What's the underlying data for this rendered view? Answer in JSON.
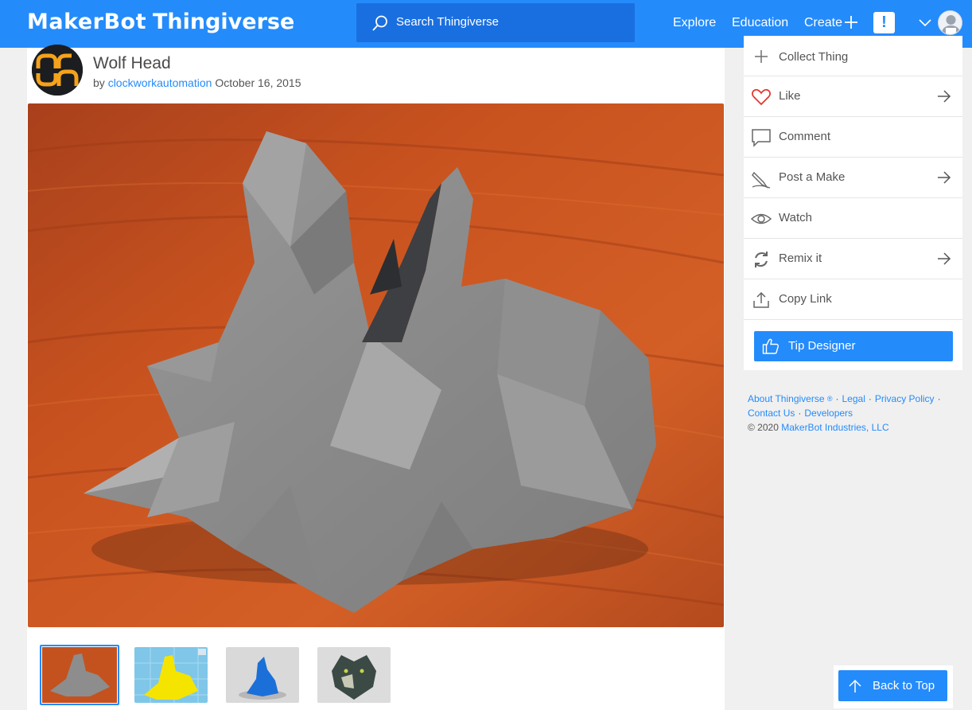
{
  "header": {
    "brand_maker": "MakerBot",
    "brand_thing": "Thingiverse",
    "search_placeholder": "Search Thingiverse",
    "nav": [
      "Explore",
      "Education",
      "Create"
    ],
    "alert_glyph": "!",
    "brand_color": "#248bfb"
  },
  "thing": {
    "title": "Wolf Head",
    "by": "by",
    "creator": "clockworkautomation",
    "date": "October 16, 2015",
    "thumbnails": [
      "photo-wolf-head-print",
      "yellow-slicer-preview",
      "blue-render",
      "painted-wolf-head"
    ]
  },
  "actions": [
    {
      "label": "Collect Thing",
      "icon": "plus-icon",
      "arrow": false
    },
    {
      "label": "Like",
      "icon": "heart-icon",
      "arrow": true
    },
    {
      "label": "Comment",
      "icon": "comment-icon",
      "arrow": false
    },
    {
      "label": "Post a Make",
      "icon": "pencil-icon",
      "arrow": true
    },
    {
      "label": "Watch",
      "icon": "eye-icon",
      "arrow": false
    },
    {
      "label": "Remix it",
      "icon": "remix-icon",
      "arrow": true
    },
    {
      "label": "Copy Link",
      "icon": "share-icon",
      "arrow": false
    }
  ],
  "tip": {
    "label": "Tip Designer",
    "icon": "thumbs-up-icon"
  },
  "footer": {
    "about": "About Thingiverse",
    "reg": "®",
    "legal": "Legal",
    "privacy": "Privacy Policy",
    "contact": "Contact Us",
    "developers": "Developers",
    "copyright": "©  2020",
    "company": "MakerBot Industries, LLC"
  },
  "back_to_top": "Back to Top"
}
